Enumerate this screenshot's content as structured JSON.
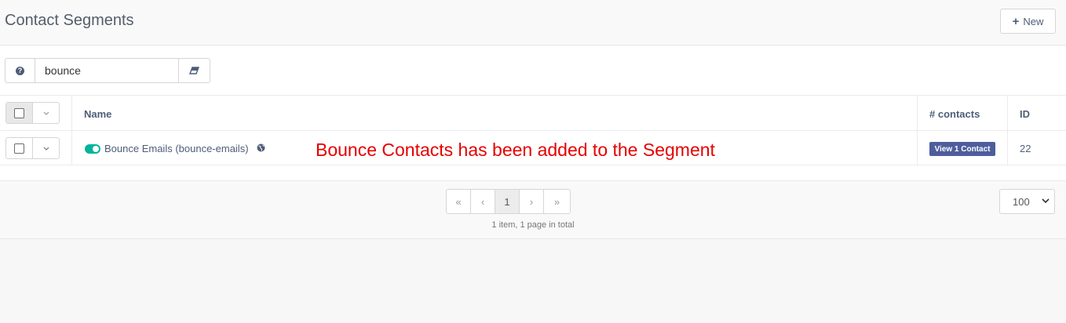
{
  "header": {
    "title": "Contact Segments",
    "new_button": {
      "icon": "plus-icon",
      "label": "New"
    }
  },
  "search": {
    "help_icon": "question-circle-icon",
    "value": "bounce",
    "clear_icon": "eraser-icon"
  },
  "table": {
    "columns": {
      "name": "Name",
      "contacts": "# contacts",
      "id": "ID"
    },
    "rows": [
      {
        "published": true,
        "name": "Bounce Emails (bounce-emails)",
        "visibility_icon": "globe-icon",
        "contacts_label": "View 1 Contact",
        "id": "22"
      }
    ]
  },
  "annotation": "Bounce Contacts has been added to the Segment",
  "pagination": {
    "first_icon": "double-chevron-left-icon",
    "prev_icon": "chevron-left-icon",
    "current_page": "1",
    "next_icon": "chevron-right-icon",
    "last_icon": "double-chevron-right-icon",
    "summary": "1 item, 1 page in total",
    "limit": "100"
  },
  "colors": {
    "annotation": "#e60000",
    "badge": "#4e5d9d",
    "toggle_on": "#00b49c"
  }
}
